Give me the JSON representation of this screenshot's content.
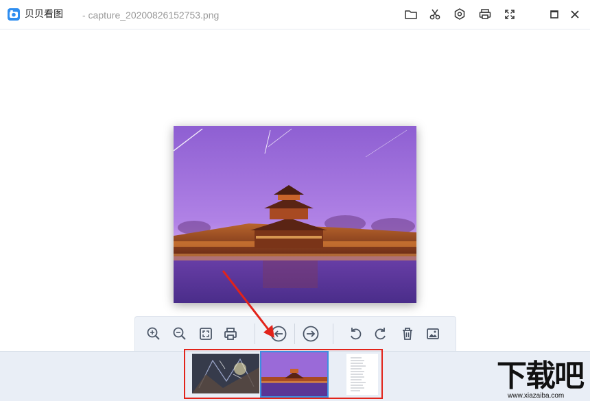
{
  "app": {
    "name": "贝贝看图",
    "file_title": "- capture_20200826152753.png"
  },
  "titlebar_icons": [
    "folder-icon",
    "scissors-icon",
    "settings-icon",
    "print-icon",
    "fullscreen-icon",
    "maximize-icon",
    "close-icon"
  ],
  "toolbar_icons": [
    "zoom-in-icon",
    "zoom-out-icon",
    "fit-screen-icon",
    "print-icon",
    "previous-icon",
    "next-icon",
    "rotate-left-icon",
    "rotate-right-icon",
    "delete-icon",
    "wallpaper-icon"
  ],
  "thumbnails": [
    {
      "name": "thumb-fantasy",
      "selected": false
    },
    {
      "name": "thumb-forbidden-city",
      "selected": true
    },
    {
      "name": "thumb-document",
      "selected": false
    }
  ],
  "watermark": {
    "text": "下载吧",
    "url": "www.xiazaiba.com"
  },
  "colors": {
    "accent": "#3d8fe0",
    "highlight_red": "#e2231a",
    "toolbar_bg": "#eef2f8"
  }
}
